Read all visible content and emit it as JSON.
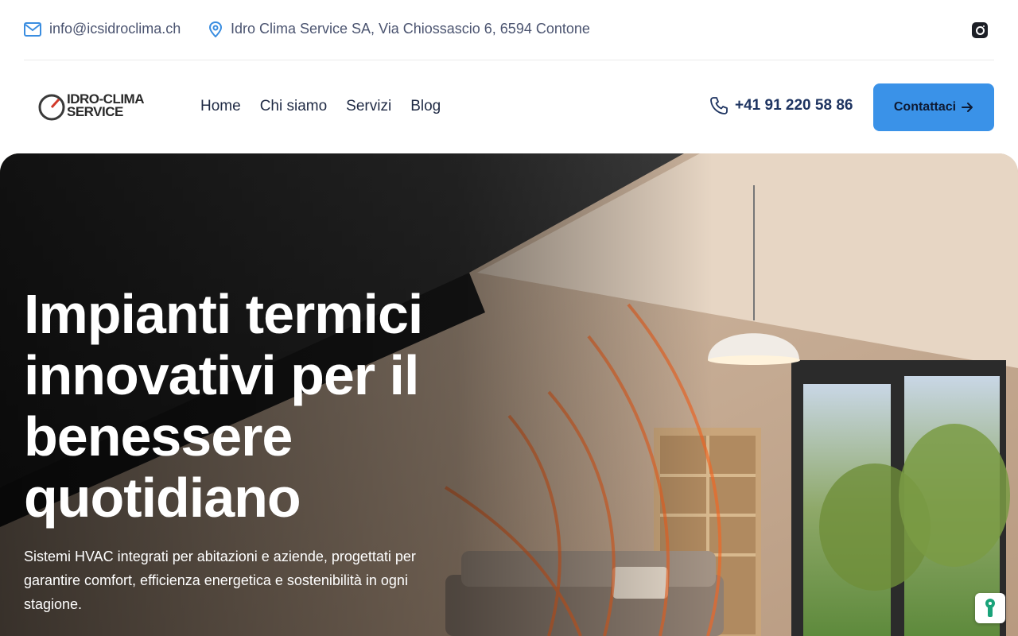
{
  "topbar": {
    "email": "info@icsidroclima.ch",
    "address": "Idro Clima Service SA, Via Chiossascio 6, 6594 Contone",
    "email_icon": "mail-icon",
    "address_icon": "map-pin-icon",
    "social_icon": "instagram-icon"
  },
  "logo": {
    "line1": "IDRO-CLIMA",
    "line2": "SERVICE"
  },
  "nav": {
    "items": [
      {
        "label": "Home"
      },
      {
        "label": "Chi siamo"
      },
      {
        "label": "Servizi"
      },
      {
        "label": "Blog"
      }
    ]
  },
  "contact": {
    "phone": "+41 91 220 58 86",
    "phone_icon": "phone-icon",
    "cta_label": "Contattaci",
    "cta_icon": "arrow-right-icon"
  },
  "hero": {
    "title_lines": [
      "Impianti termici",
      "innovativi per il",
      "benessere",
      "quotidiano"
    ],
    "subtitle": "Sistemi HVAC integrati per abitazioni e aziende, progettati per garantire comfort, efficienza energetica e sostenibilità in ogni stagione."
  },
  "colors": {
    "accent": "#3a92e8",
    "navy": "#1e3461",
    "icon_blue": "#3a8de0"
  },
  "floating_button_icon": "accessibility-icon"
}
